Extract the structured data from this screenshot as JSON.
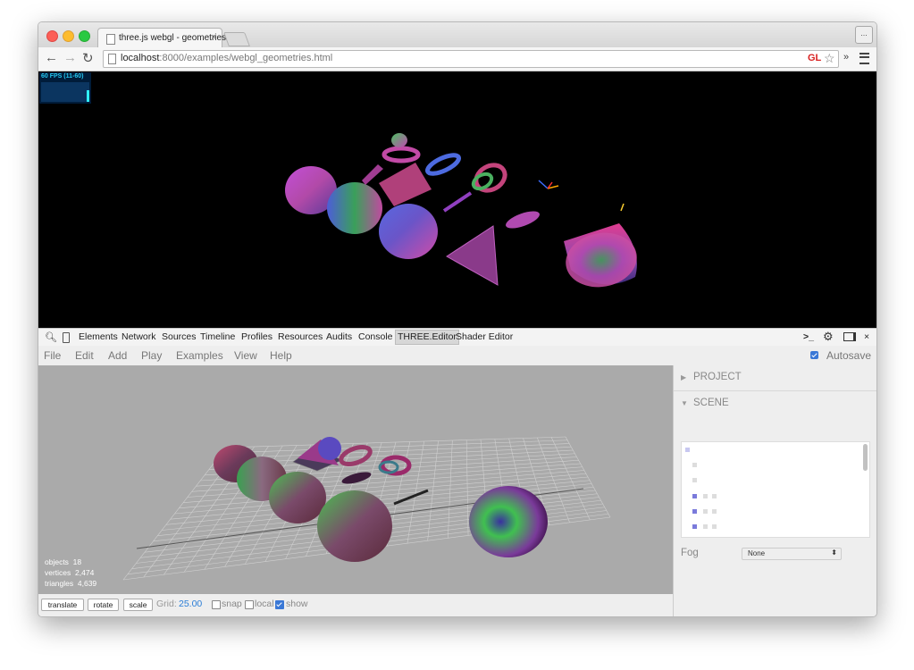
{
  "browser": {
    "tab_title": "three.js webgl - geometries",
    "tab_close": "×",
    "url_host": "localhost",
    "url_rest": ":8000/examples/webgl_geometries.html",
    "gl_badge": "GL",
    "star_glyph": "☆",
    "overflow_glyph": "»",
    "user_button": "...",
    "back_glyph": "←",
    "forward_glyph": "→",
    "reload_glyph": "↻"
  },
  "viewport": {
    "fps_text": "60 FPS (11-60)",
    "fps_level": 0.6
  },
  "devtools": {
    "tabs": [
      "Elements",
      "Network",
      "Sources",
      "Timeline",
      "Profiles",
      "Resources",
      "Audits",
      "Console",
      "THREE.Editor",
      "Shader Editor"
    ],
    "active_tab": "THREE.Editor",
    "close_glyph": "×",
    "terminal_glyph": ">_"
  },
  "editor": {
    "menu": [
      "File",
      "Edit",
      "Add",
      "Play",
      "Examples",
      "View",
      "Help"
    ],
    "autosave_label": "Autosave",
    "autosave_checked": true,
    "stats": {
      "objects_label": "objects",
      "objects": "18",
      "vertices_label": "vertices",
      "vertices": "2,474",
      "triangles_label": "triangles",
      "triangles": "4,639"
    },
    "sidebar": {
      "project_label": "PROJECT",
      "scene_label": "SCENE",
      "fog_label": "Fog",
      "fog_value": "None"
    },
    "toolbar": {
      "translate": "translate",
      "rotate": "rotate",
      "scale": "scale",
      "grid_label": "Grid:",
      "grid_value": "25.00",
      "snap_label": "snap",
      "snap_checked": false,
      "local_label": "local",
      "local_checked": false,
      "show_label": "show",
      "show_checked": true
    }
  },
  "colors": {
    "accent_blue": "#3a78d6",
    "grid_value": "#2a7dd6",
    "gl_red": "#d81f1f",
    "fps_cyan": "#26c7f0"
  }
}
